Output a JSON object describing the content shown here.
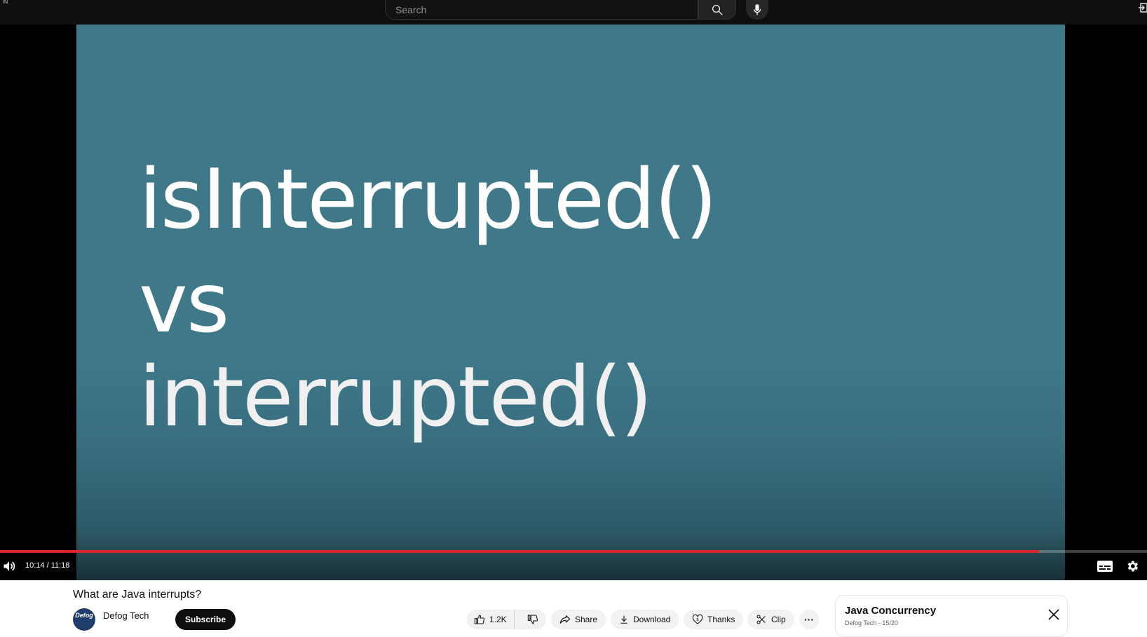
{
  "header": {
    "country_code": "IN",
    "search": {
      "placeholder": "Search",
      "value": ""
    },
    "search_button_icon": "search-icon",
    "mic_button_icon": "mic-icon",
    "corner_icon": "sign-in-icon"
  },
  "player": {
    "slide_lines": [
      "isInterrupted()",
      "vs",
      "interrupted()"
    ],
    "current_time": "10:14",
    "duration": "11:18",
    "time_display": "10:14 / 11:18",
    "progress_fraction": 0.9056,
    "colors": {
      "slide_background": "#3e7889",
      "progress": "#d9262b"
    },
    "icons": [
      "volume-icon",
      "captions-icon",
      "settings-icon"
    ]
  },
  "video": {
    "title": "What are Java interrupts?",
    "channel": {
      "name": "Defog Tech",
      "avatar_text": "Defog"
    },
    "subscribe_label": "Subscribe",
    "actions": {
      "likes": "1.2K",
      "share": "Share",
      "download": "Download",
      "thanks": "Thanks",
      "clip": "Clip",
      "more": "···"
    }
  },
  "playlist": {
    "title": "Java Concurrency",
    "meta": "Defog Tech - 15/20"
  }
}
